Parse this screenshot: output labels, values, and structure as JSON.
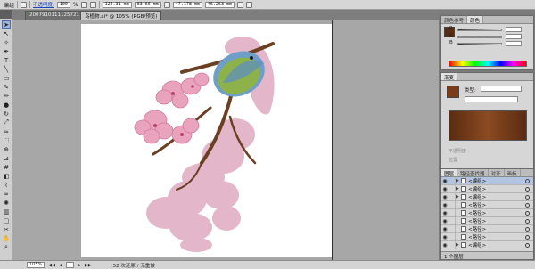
{
  "control_bar": {
    "selection_label": "编组",
    "opacity_link": "不透明度:",
    "opacity_value": "100",
    "opacity_unit": "%",
    "x_value": "124.31 mm",
    "y_value": "83.66 mm",
    "w_value": "47.178 mm",
    "h_value": "46.263 mm"
  },
  "doc_tabs": [
    {
      "label": "2007910111125721"
    },
    {
      "label": "鸟植物.ai* @ 105% (RGB/预览)"
    }
  ],
  "status_bar": {
    "zoom": "105%",
    "artboard": "1",
    "info": "52 次还原 / 无重做"
  },
  "color_panel": {
    "tabs": [
      "颜色参考",
      "颜色"
    ],
    "channels": [
      "R",
      "G",
      "B"
    ]
  },
  "gradient_panel": {
    "tab": "渐变",
    "type_label": "类型:",
    "location_label": "位置",
    "opacity_label": "不透明度"
  },
  "layers_panel": {
    "tabs": [
      "图层",
      "路径查找器",
      "对齐",
      "画板",
      "画笔库参考"
    ],
    "rows": [
      {
        "name": "<编组>",
        "selected": true
      },
      {
        "name": "<编组>",
        "selected": false
      },
      {
        "name": "<编组>",
        "selected": false
      },
      {
        "name": "<路径>",
        "selected": false
      },
      {
        "name": "<路径>",
        "selected": false
      },
      {
        "name": "<路径>",
        "selected": false
      },
      {
        "name": "<路径>",
        "selected": false
      },
      {
        "name": "<路径>",
        "selected": false
      },
      {
        "name": "<编组>",
        "selected": false
      },
      {
        "name": "<复合路径>",
        "selected": false
      }
    ],
    "footer": "1 个图层"
  },
  "colors": {
    "petal": "#e3b6c9",
    "petal_dark": "#d98aa8",
    "branch": "#6b3f22",
    "bird": "#8db24a",
    "bird_wing": "#5f8fbf",
    "gradient_swatch": "#7a3d18"
  }
}
